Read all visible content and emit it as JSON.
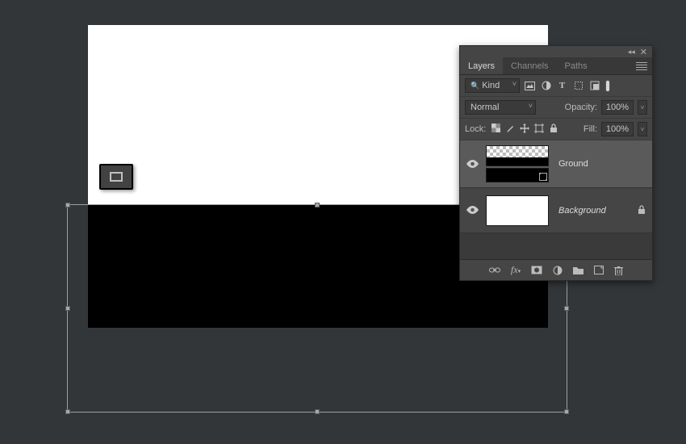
{
  "colors": {
    "app_bg": "#333639",
    "panel_bg": "#454545",
    "canvas_top": "#ffffff",
    "canvas_bottom": "#000000"
  },
  "canvas": {
    "top_color": "#ffffff",
    "bottom_color": "#000000"
  },
  "tool_overlay": {
    "name": "rectangle-tool"
  },
  "panel": {
    "tabs": [
      {
        "label": "Layers",
        "active": true
      },
      {
        "label": "Channels",
        "active": false
      },
      {
        "label": "Paths",
        "active": false
      }
    ],
    "filter": {
      "kind_label": "Kind",
      "icons": [
        "image-filter",
        "adjust-filter",
        "type-filter",
        "shape-filter",
        "smart-filter"
      ]
    },
    "blend": {
      "mode": "Normal",
      "opacity_label": "Opacity:",
      "opacity_value": "100%"
    },
    "lock": {
      "label": "Lock:",
      "icons": [
        "transparency",
        "brush",
        "move",
        "artboard",
        "all"
      ],
      "fill_label": "Fill:",
      "fill_value": "100%"
    },
    "layers": [
      {
        "visible": true,
        "name": "Ground",
        "type": "shape",
        "has_vector_mask": true,
        "selected": true,
        "locked": false
      },
      {
        "visible": true,
        "name": "Background",
        "type": "pixel",
        "has_vector_mask": false,
        "selected": false,
        "locked": true,
        "italic": true
      }
    ],
    "footer_icons": [
      "link",
      "fx",
      "mask",
      "adjustment",
      "group",
      "new-layer",
      "delete"
    ]
  }
}
